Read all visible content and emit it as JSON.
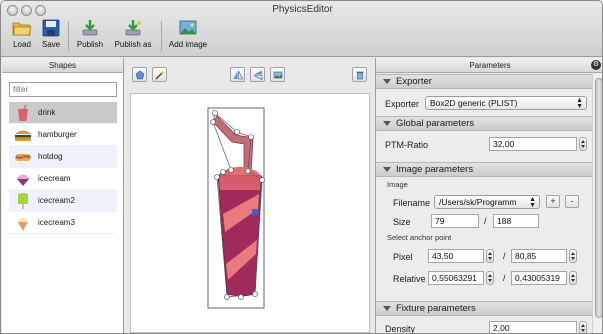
{
  "window": {
    "title": "PhysicsEditor"
  },
  "toolbar": {
    "load": "Load",
    "save": "Save",
    "publish": "Publish",
    "publish_as": "Publish as",
    "add_image": "Add image"
  },
  "shapes": {
    "header": "Shapes",
    "filter_placeholder": "filter",
    "items": [
      {
        "label": "drink",
        "icon": "drink-icon"
      },
      {
        "label": "hamburger",
        "icon": "hamburger-icon"
      },
      {
        "label": "hotdog",
        "icon": "hotdog-icon"
      },
      {
        "label": "icecream",
        "icon": "icecream-icon"
      },
      {
        "label": "icecream2",
        "icon": "icecream2-icon"
      },
      {
        "label": "icecream3",
        "icon": "icecream3-icon"
      }
    ],
    "selected": "drink"
  },
  "parameters": {
    "header": "Parameters",
    "exporter": {
      "section": "Exporter",
      "label": "Exporter",
      "value": "Box2D generic (PLIST)"
    },
    "global": {
      "section": "Global parameters",
      "ptm_label": "PTM-Ratio",
      "ptm_value": "32,00"
    },
    "image": {
      "section": "Image parameters",
      "group_label": "Image",
      "filename_label": "Filename",
      "filename_value": "/Users/sk/Programm",
      "add": "+",
      "remove": "-",
      "size_label": "Size",
      "width": "79",
      "slash": "/",
      "height": "188",
      "anchor_label": "Select anchor point",
      "pixel_label": "Pixel",
      "pixel_x": "43,50",
      "pixel_y": "80,85",
      "relative_label": "Relative",
      "relative_x": "0,55063291",
      "relative_y": "0,43005319"
    },
    "fixture": {
      "section": "Fixture parameters",
      "density_label": "Density",
      "density_value": "2,00"
    }
  },
  "colors": {
    "cup_fill": "#d9636b",
    "cup_band": "#a02a5a",
    "straw": "#c06f78",
    "outline": "#555555",
    "selection": "#c9c9c9",
    "alt_row": "#eef3fb"
  }
}
